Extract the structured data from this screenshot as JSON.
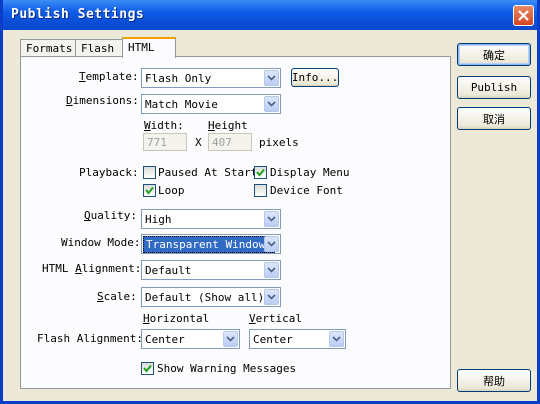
{
  "window": {
    "title": "Publish Settings"
  },
  "tabs": [
    {
      "label": "Formats"
    },
    {
      "label": "Flash"
    },
    {
      "label": "HTML"
    }
  ],
  "html_tab": {
    "template": {
      "label": "Template:",
      "value": "Flash Only",
      "info_button": "Info..."
    },
    "dimensions": {
      "label": "Dimensions:",
      "value": "Match Movie",
      "width_label": "Width:",
      "height_label": "Height",
      "width_value": "771",
      "x_label": "X",
      "height_value": "407",
      "units": "pixels"
    },
    "playback": {
      "label": "Playback:",
      "paused": {
        "label": "Paused At Start",
        "checked": false
      },
      "display_menu": {
        "label": "Display Menu",
        "checked": true
      },
      "loop": {
        "label": "Loop",
        "checked": true
      },
      "device_font": {
        "label": "Device Font",
        "checked": false
      }
    },
    "quality": {
      "label": "Quality:",
      "value": "High"
    },
    "window_mode": {
      "label": "Window Mode:",
      "value": "Transparent Windowl"
    },
    "html_alignment": {
      "label": "HTML Alignment:",
      "value": "Default"
    },
    "scale": {
      "label": "Scale:",
      "value": "Default (Show all)"
    },
    "flash_alignment": {
      "label": "Flash Alignment:",
      "horizontal_label": "Horizontal",
      "vertical_label": "Vertical",
      "horizontal_value": "Center",
      "vertical_value": "Center"
    },
    "show_warnings": {
      "label": "Show Warning Messages",
      "checked": true
    }
  },
  "buttons": {
    "ok": "确定",
    "publish": "Publish",
    "cancel": "取消",
    "help": "帮助"
  },
  "colors": {
    "titlebar": "#0a4fd8",
    "face": "#ece9d8",
    "selection": "#316ac5",
    "active_tab": "#f0a000"
  }
}
